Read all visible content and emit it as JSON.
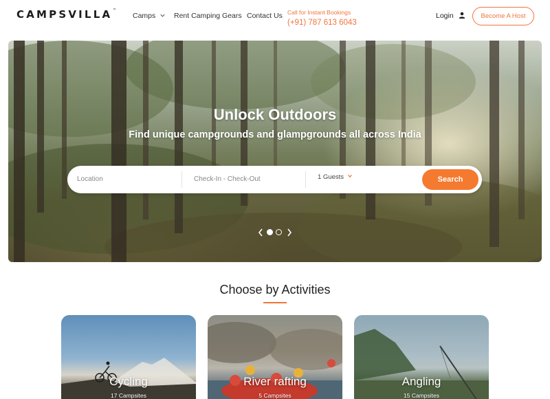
{
  "header": {
    "logo": "CAMPSVILLA",
    "logo_tm": "™",
    "nav": {
      "camps": "Camps",
      "rent": "Rent Camping Gears",
      "contact": "Contact Us"
    },
    "call_label": "Call for Instant Bookings",
    "call_phone": "(+91) 787 613 6043",
    "login": "Login",
    "become_host": "Become A Host",
    "accent_color": "#f2743a"
  },
  "hero": {
    "title": "Unlock Outdoors",
    "subtitle": "Find unique campgrounds and glampgrounds all across India",
    "search": {
      "location_placeholder": "Location",
      "dates_placeholder": "Check-In - Check-Out",
      "guests": "1 Guests",
      "button": "Search"
    },
    "slider": {
      "slide_count": 2,
      "active_slide": 1
    }
  },
  "activities": {
    "title": "Choose by Activities",
    "cards": [
      {
        "title": "Cycling",
        "count": "17 Campsites"
      },
      {
        "title": "River rafting",
        "count": "5 Campsites"
      },
      {
        "title": "Angling",
        "count": "15 Campsites"
      }
    ]
  }
}
